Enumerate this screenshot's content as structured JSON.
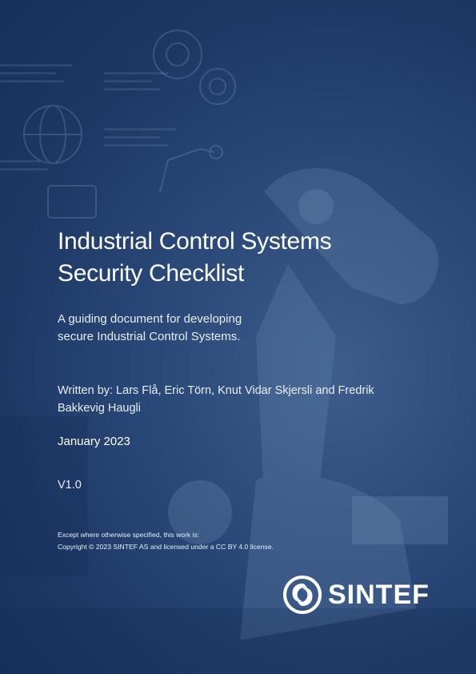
{
  "cover": {
    "title_line1": "Industrial Control Systems",
    "title_line2": "Security Checklist",
    "subtitle_line1": "A guiding document for developing",
    "subtitle_line2": "secure Industrial Control Systems.",
    "authors_line1": "Written by: Lars Flå, Eric Törn, Knut Vidar Skjersli and Fredrik",
    "authors_line2": "Bakkevig Haugli",
    "date": "January 2023",
    "version": "V1.0",
    "license_line1": "Except where otherwise specified, this work is:",
    "license_line2": "Copyright © 2023 SINTEF AS and licensed under a CC BY 4.0 license."
  },
  "logo": {
    "text": "SINTEF",
    "icon": "sintef-logo-icon"
  },
  "colors": {
    "background": "#1e3866",
    "text": "#ffffff"
  }
}
